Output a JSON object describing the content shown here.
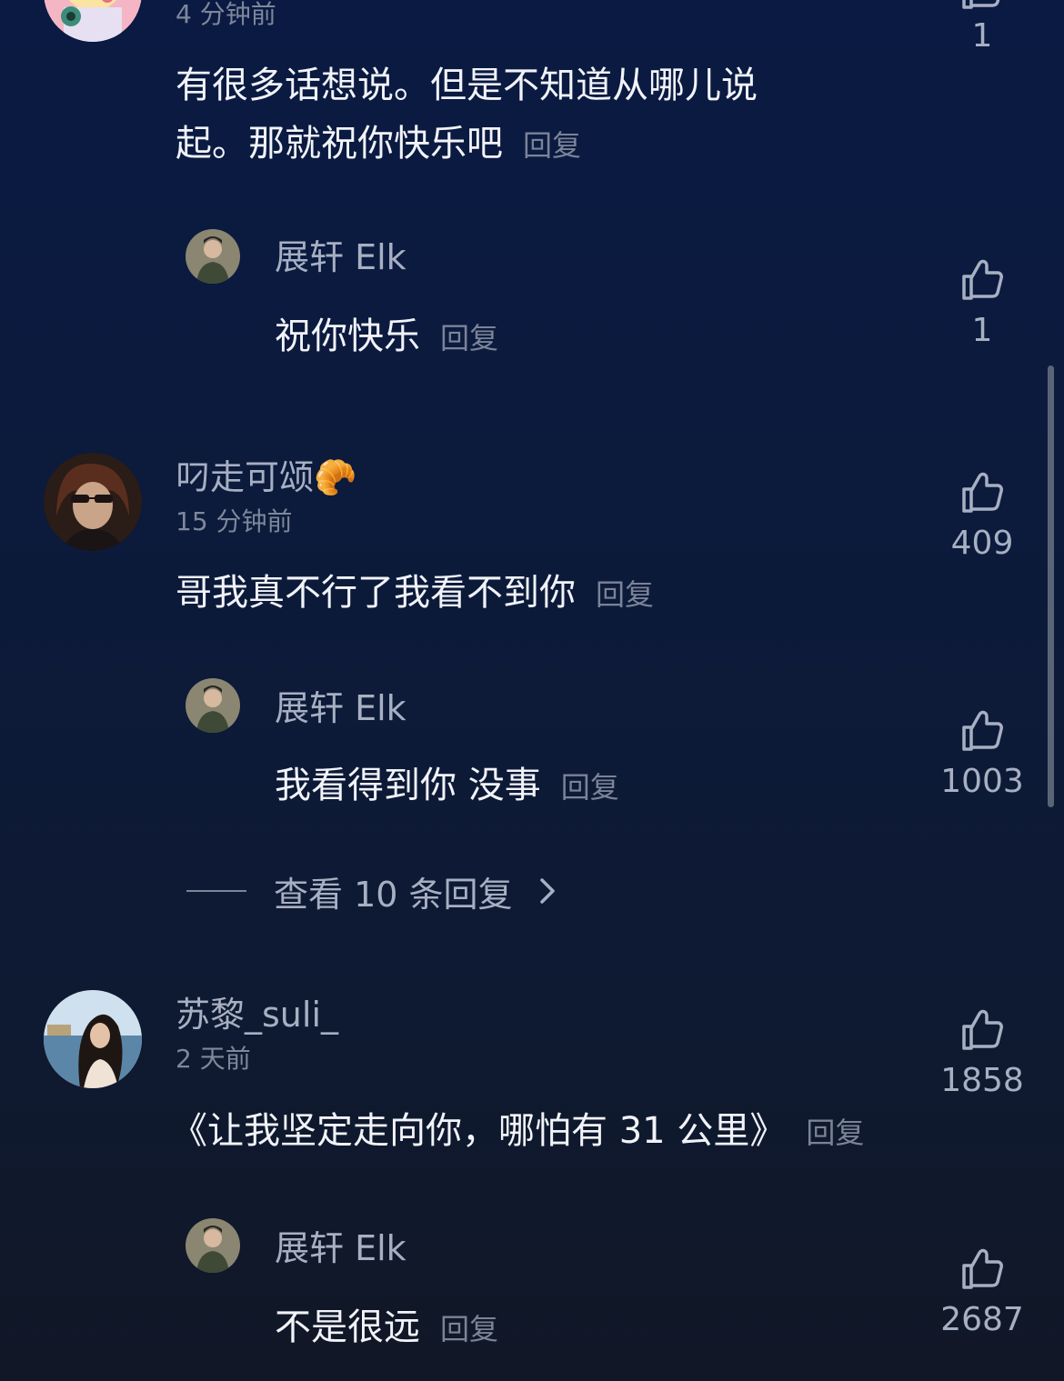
{
  "comments": [
    {
      "time": "4 分钟前",
      "text_line1": "有很多话想说。但是不知道从哪儿说",
      "text_line2": "起。那就祝你快乐吧",
      "reply_label": "回复",
      "likes": "1",
      "reply": {
        "user": "展轩 Elk",
        "text": "祝你快乐",
        "reply_label": "回复",
        "likes": "1"
      }
    },
    {
      "user": "叼走可颂🥐",
      "time": "15 分钟前",
      "text": "哥我真不行了我看不到你",
      "reply_label": "回复",
      "likes": "409",
      "reply": {
        "user": "展轩 Elk",
        "text": "我看得到你 没事",
        "reply_label": "回复",
        "likes": "1003"
      },
      "view_more": "查看 10 条回复"
    },
    {
      "user": "苏黎_suli_",
      "time": "2 天前",
      "text": "《让我坚定走向你，哪怕有 31 公里》",
      "reply_label": "回复",
      "likes": "1858",
      "reply": {
        "user": "展轩 Elk",
        "text": "不是很远",
        "reply_label": "回复",
        "likes": "2687"
      }
    }
  ],
  "colors": {
    "background_top": "#0a1a42",
    "background_bottom": "#111726",
    "text_primary": "#f1f3f8",
    "text_secondary": "#a7afc2",
    "text_muted": "#7b8397"
  },
  "icons": {
    "like": "thumbs-up-icon",
    "expand": "chevron-right-icon"
  }
}
